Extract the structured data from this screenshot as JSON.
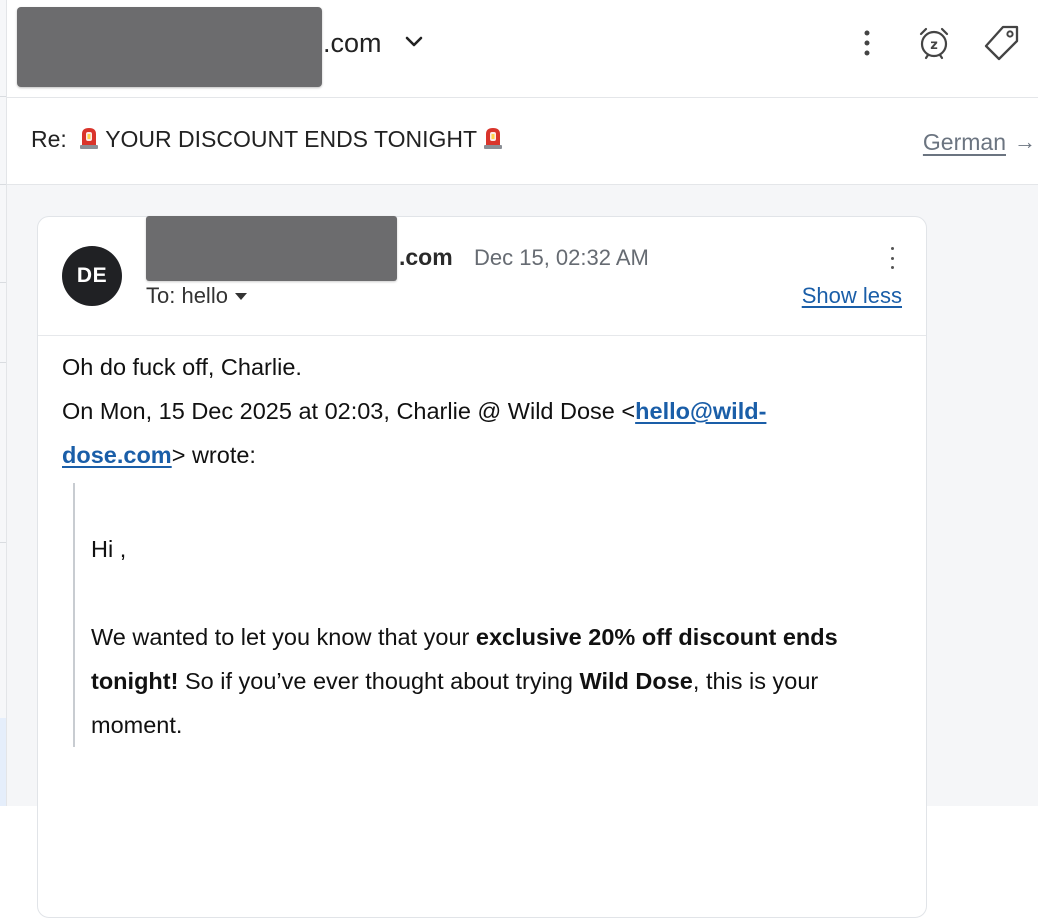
{
  "header": {
    "sender_domain_visible": ".com",
    "icons": {
      "expand": "chevron-down-icon",
      "more": "more-vertical-icon",
      "snooze": "alarm-clock-icon",
      "label": "tag-icon"
    }
  },
  "subject_bar": {
    "prefix": "Re:",
    "subject": "YOUR DISCOUNT ENDS TONIGHT",
    "siren_icon": "police-light-emoji",
    "translate_label": "German",
    "translate_arrow": "→"
  },
  "message": {
    "avatar_initials": "DE",
    "from_domain_visible": ".com",
    "date": "Dec 15, 02:32 AM",
    "to_label": "To: hello",
    "show_less": "Show less",
    "reply_text": "Oh do fuck off, Charlie.",
    "quote_header_prefix": "On Mon, 15 Dec 2025 at 02:03, Charlie @ Wild Dose <",
    "quote_header_email": "hello@wild-dose.com",
    "quote_header_email_line1": "hello@wild-",
    "quote_header_email_line2": "dose.com",
    "quote_header_suffix": "> wrote:",
    "quoted": {
      "greeting": "Hi ,",
      "p1_a": "We wanted to let you know that your ",
      "p1_b": "exclusive 20% off discount ends tonight!",
      "p1_c": " So if you’ve ever thought about trying ",
      "p1_d": "Wild Dose",
      "p1_e": ", this is your moment."
    }
  },
  "colors": {
    "link": "#1a5ea8",
    "avatar_bg": "#202124",
    "redaction": "#6c6c6e",
    "siren_red": "#d9342b"
  }
}
